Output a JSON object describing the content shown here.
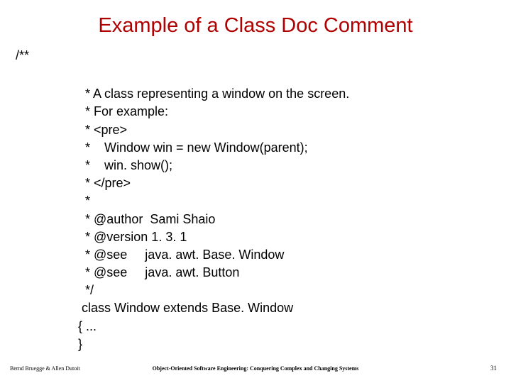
{
  "title": "Example of a Class Doc Comment",
  "opener": "/**",
  "lines": [
    "  * A class representing a window on the screen.",
    "  * For example:",
    "  * <pre>",
    "  *    Window win = new Window(parent);",
    "  *    win. show();",
    "  * </pre>",
    "  *",
    "  * @author  Sami Shaio",
    "  * @version 1. 3. 1",
    "  * @see     java. awt. Base. Window",
    "  * @see     java. awt. Button",
    "  */",
    " class Window extends Base. Window",
    "{ ...",
    "}"
  ],
  "footer": {
    "left": "Bernd Bruegge & Allen Dutoit",
    "center": "Object-Oriented Software Engineering: Conquering Complex and Changing Systems",
    "right": "31"
  }
}
